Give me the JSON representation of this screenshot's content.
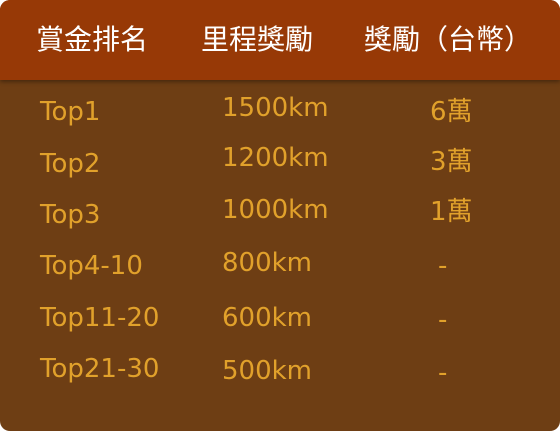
{
  "table": {
    "headers": [
      "賞金排名",
      "里程獎勵",
      "獎勵（台幣）"
    ],
    "rows": [
      {
        "rank": "Top1",
        "distance": "1500km",
        "prize": "6萬"
      },
      {
        "rank": "Top2",
        "distance": "1200km",
        "prize": "3萬"
      },
      {
        "rank": "Top3",
        "distance": "1000km",
        "prize": "1萬"
      },
      {
        "rank": "Top4-10",
        "distance": "800km",
        "prize": "-"
      },
      {
        "rank": "Top11-20",
        "distance": "600km",
        "prize": "-"
      },
      {
        "rank": "Top21-30",
        "distance": "500km",
        "prize": "-"
      }
    ]
  },
  "colors": {
    "header_bg": "#973906",
    "body_bg": "#6e3e14",
    "header_text": "#ffffff",
    "body_text": "#e1a12b"
  }
}
